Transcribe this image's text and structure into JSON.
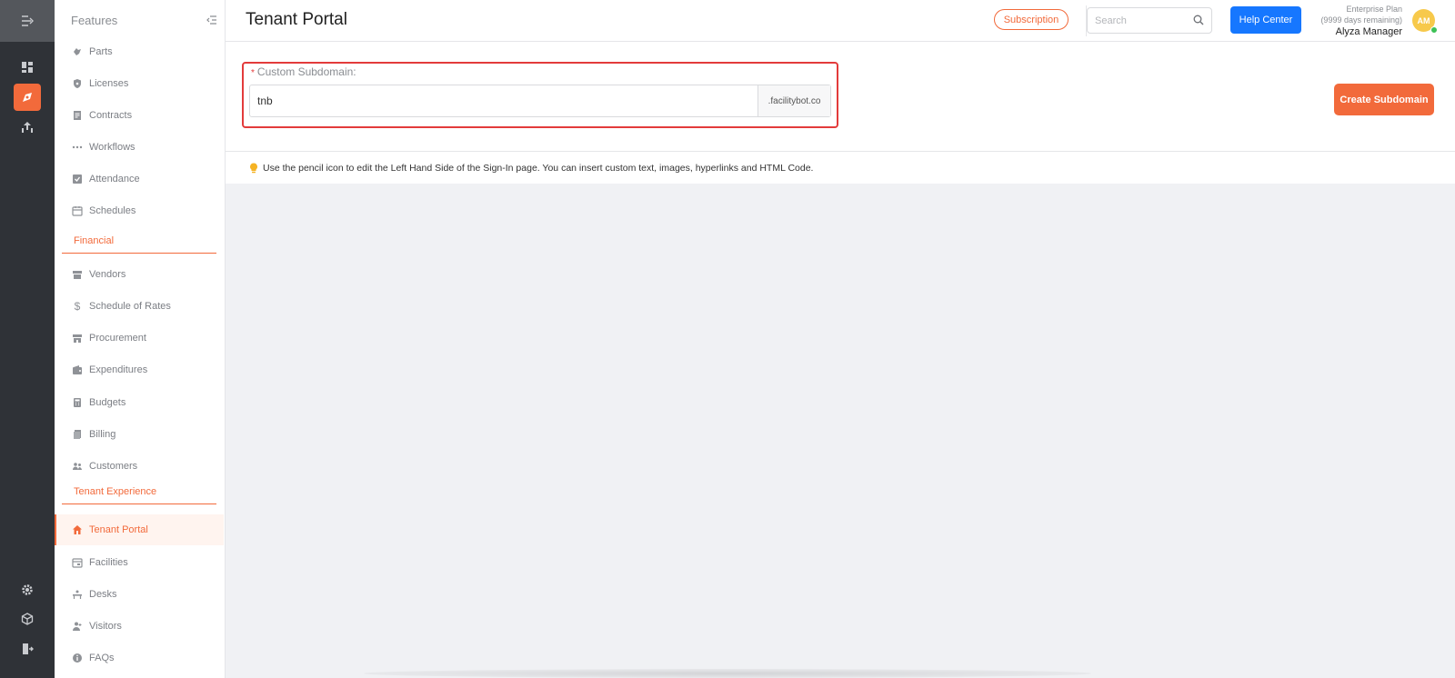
{
  "rail": {
    "items": [
      {
        "icon": "dashboard-icon"
      },
      {
        "icon": "features-icon",
        "active": true
      },
      {
        "icon": "reports-icon"
      },
      {
        "icon": "settings-icon"
      },
      {
        "icon": "cube-icon"
      },
      {
        "icon": "logout-icon"
      }
    ]
  },
  "features": {
    "title": "Features",
    "items": [
      {
        "label": "Parts",
        "icon": "parts-icon"
      },
      {
        "label": "Licenses",
        "icon": "shield-icon"
      },
      {
        "label": "Contracts",
        "icon": "contract-icon"
      },
      {
        "label": "Workflows",
        "icon": "dots-icon"
      },
      {
        "label": "Attendance",
        "icon": "checkbox-icon"
      },
      {
        "label": "Schedules",
        "icon": "calendar-icon"
      },
      {
        "label": "Vendors",
        "icon": "store-icon"
      },
      {
        "label": "Schedule of Rates",
        "icon": "dollar-icon"
      },
      {
        "label": "Procurement",
        "icon": "shop-icon"
      },
      {
        "label": "Expenditures",
        "icon": "wallet-icon"
      },
      {
        "label": "Budgets",
        "icon": "calculator-icon"
      },
      {
        "label": "Billing",
        "icon": "billing-icon"
      },
      {
        "label": "Customers",
        "icon": "people-icon"
      },
      {
        "label": "Tenant Portal",
        "icon": "home-icon",
        "active": true
      },
      {
        "label": "Facilities",
        "icon": "facility-calendar-icon"
      },
      {
        "label": "Desks",
        "icon": "desk-icon"
      },
      {
        "label": "Visitors",
        "icon": "visitor-icon"
      },
      {
        "label": "FAQs",
        "icon": "info-icon"
      }
    ],
    "sections": {
      "financial": "Financial",
      "tenant_experience": "Tenant Experience"
    }
  },
  "header": {
    "title": "Tenant Portal",
    "subscription_label": "Subscription",
    "search_placeholder": "Search",
    "help_label": "Help Center",
    "plan_name": "Enterprise Plan",
    "plan_remaining": "(9999 days remaining)",
    "user_name": "Alyza Manager",
    "avatar_initials": "AM"
  },
  "form": {
    "label": "Custom Subdomain",
    "value": "tnb",
    "suffix": ".facilitybot.co",
    "create_label": "Create Subdomain"
  },
  "tip": {
    "text": "Use the pencil icon to edit the Left Hand Side of the Sign-In page. You can insert custom text, images, hyperlinks and HTML Code."
  },
  "colors": {
    "accent": "#f26a3b",
    "primary": "#1677ff",
    "highlight": "#e33b3b",
    "rail": "#2f3237"
  }
}
